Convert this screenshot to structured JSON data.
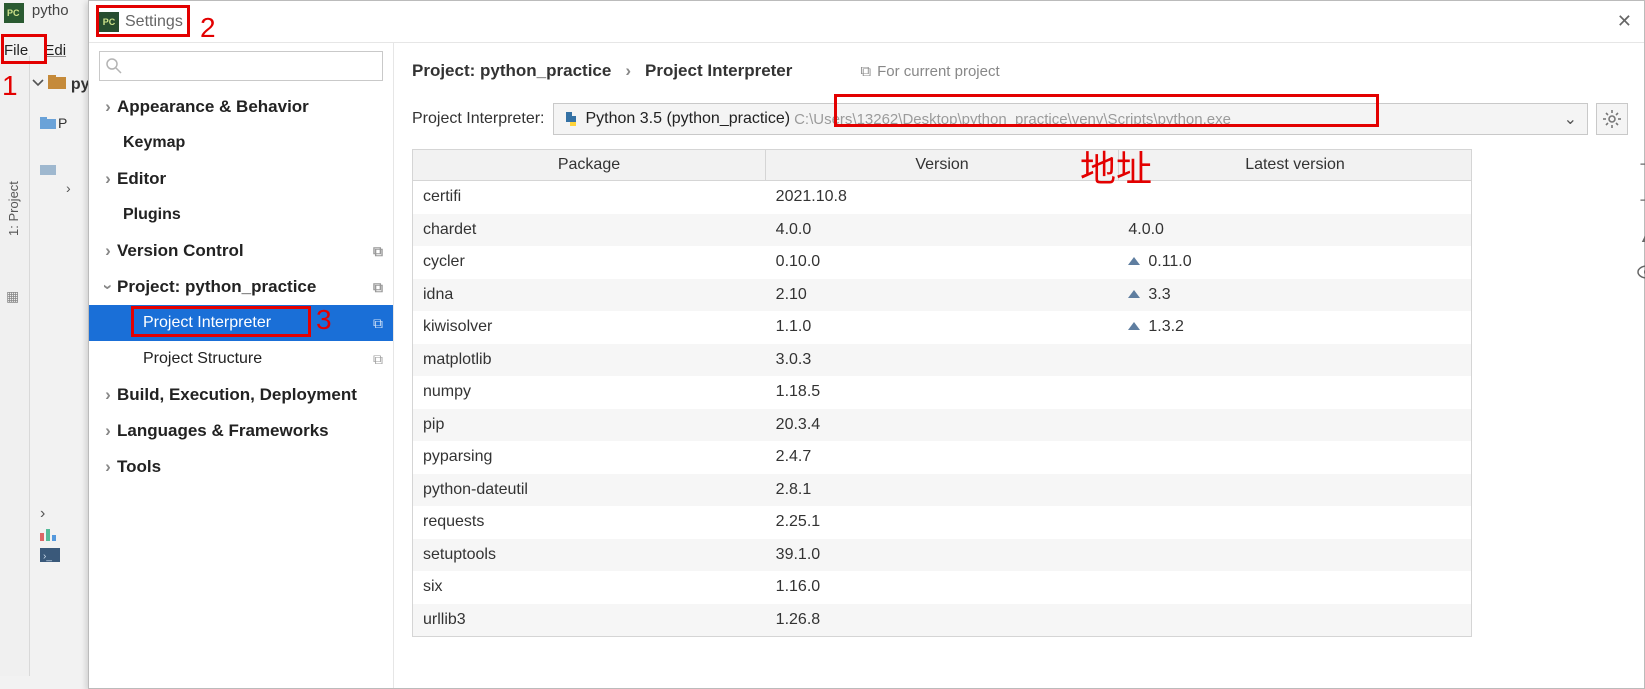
{
  "app": {
    "title": "pytho",
    "menu": {
      "file_label": "File",
      "edit_label": "Edi"
    },
    "project_tool_label": "1: Project",
    "project_root": "pyt",
    "project_p": "P"
  },
  "settings": {
    "title": "Settings",
    "close_glyph": "✕",
    "tree": {
      "appearance": "Appearance & Behavior",
      "keymap": "Keymap",
      "editor": "Editor",
      "plugins": "Plugins",
      "vcs": "Version Control",
      "project": "Project: python_practice",
      "interpreter": "Project Interpreter",
      "structure": "Project Structure",
      "build": "Build, Execution, Deployment",
      "lang": "Languages & Frameworks",
      "tools": "Tools"
    },
    "breadcrumbs": {
      "a": "Project: python_practice",
      "b": "Project Interpreter",
      "for_current": "For current project"
    },
    "interp": {
      "label": "Project Interpreter:",
      "value": "Python 3.5 (python_practice)",
      "path": "C:\\Users\\13262\\Desktop\\python_practice\\venv\\Scripts\\python.exe"
    },
    "columns": {
      "pkg": "Package",
      "ver": "Version",
      "latest": "Latest version"
    },
    "packages": [
      {
        "name": "certifi",
        "version": "2021.10.8",
        "latest": "",
        "up": false
      },
      {
        "name": "chardet",
        "version": "4.0.0",
        "latest": "4.0.0",
        "up": false
      },
      {
        "name": "cycler",
        "version": "0.10.0",
        "latest": "0.11.0",
        "up": true
      },
      {
        "name": "idna",
        "version": "2.10",
        "latest": "3.3",
        "up": true
      },
      {
        "name": "kiwisolver",
        "version": "1.1.0",
        "latest": "1.3.2",
        "up": true
      },
      {
        "name": "matplotlib",
        "version": "3.0.3",
        "latest": "",
        "up": false
      },
      {
        "name": "numpy",
        "version": "1.18.5",
        "latest": "",
        "up": false
      },
      {
        "name": "pip",
        "version": "20.3.4",
        "latest": "",
        "up": false
      },
      {
        "name": "pyparsing",
        "version": "2.4.7",
        "latest": "",
        "up": false
      },
      {
        "name": "python-dateutil",
        "version": "2.8.1",
        "latest": "",
        "up": false
      },
      {
        "name": "requests",
        "version": "2.25.1",
        "latest": "",
        "up": false
      },
      {
        "name": "setuptools",
        "version": "39.1.0",
        "latest": "",
        "up": false
      },
      {
        "name": "six",
        "version": "1.16.0",
        "latest": "",
        "up": false
      },
      {
        "name": "urllib3",
        "version": "1.26.8",
        "latest": "",
        "up": false
      }
    ]
  },
  "annotations": {
    "n1": "1",
    "n2": "2",
    "n3": "3",
    "addr": "地址"
  }
}
